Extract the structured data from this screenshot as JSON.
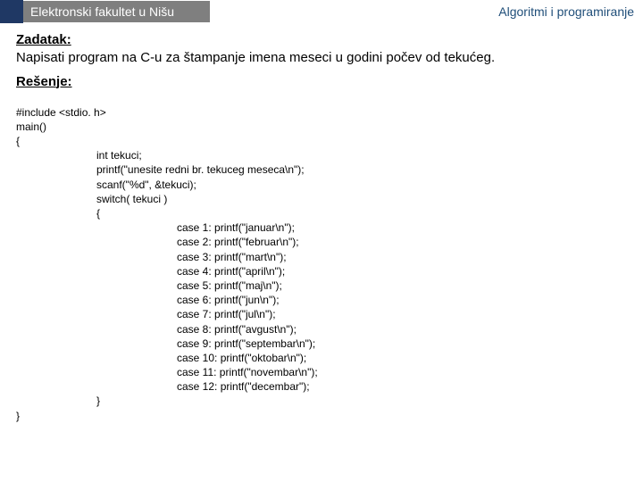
{
  "header": {
    "left": "Elektronski fakultet u Nišu",
    "right": "Algoritmi i programiranje"
  },
  "task": {
    "heading": "Zadatak:",
    "text": "Napisati program na C-u za štampanje imena meseci u godini počev od tekućeg."
  },
  "solution": {
    "heading": "Rešenje:",
    "lines_top": [
      "#include <stdio. h>",
      "main()",
      "{"
    ],
    "lines_indent1_a": [
      "int tekuci;",
      "printf(\"unesite redni br. tekuceg meseca\\n\");",
      "scanf(\"%d\", &tekuci);",
      "switch( tekuci )",
      "{"
    ],
    "lines_indent2": [
      "case 1: printf(\"januar\\n\");",
      "case 2: printf(\"februar\\n\");",
      "case 3: printf(\"mart\\n\");",
      "case 4: printf(\"april\\n\");",
      "case 5: printf(\"maj\\n\");",
      "case 6: printf(\"jun\\n\");",
      "case 7: printf(\"jul\\n\");",
      "case 8: printf(\"avgust\\n\");",
      "case 9: printf(\"septembar\\n\");",
      "case 10: printf(\"oktobar\\n\");",
      "case 11: printf(\"novembar\\n\");",
      "case 12: printf(\"decembar\");"
    ],
    "lines_indent1_b": [
      "}"
    ],
    "lines_bottom": [
      "}"
    ]
  }
}
